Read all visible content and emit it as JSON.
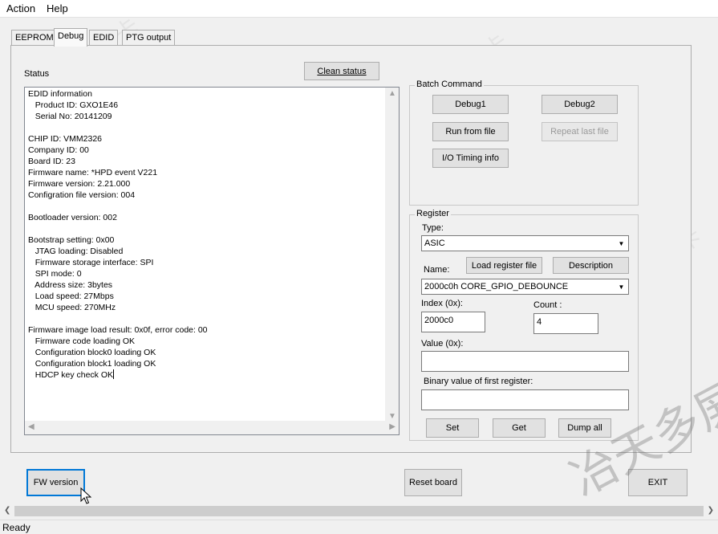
{
  "menu": {
    "action": "Action",
    "help": "Help"
  },
  "tabs": [
    "EEPROM",
    "Debug",
    "EDID",
    "PTG output"
  ],
  "status": {
    "label": "Status",
    "clean_button": "Clean status",
    "lines": "EDID information\n   Product ID: GXO1E46\n   Serial No: 20141209\n\nCHIP ID: VMM2326\nCompany ID: 00\nBoard ID: 23\nFirmware name: *HPD event V221\nFirmware version: 2.21.000\nConfigration file version: 004\n\nBootloader version: 002\n\nBootstrap setting: 0x00\n   JTAG loading: Disabled\n   Firmware storage interface: SPI\n   SPI mode: 0\n   Address size: 3bytes\n   Load speed: 27Mbps\n   MCU speed: 270MHz\n\nFirmware image load result: 0x0f, error code: 00\n   Firmware code loading OK\n   Configuration block0 loading OK\n   Configuration block1 loading OK\n   HDCP key check OK"
  },
  "batch": {
    "title": "Batch Command",
    "debug1": "Debug1",
    "debug2": "Debug2",
    "run_from_file": "Run from file",
    "repeat_last_file": "Repeat last file",
    "io_timing_info": "I/O Timing info"
  },
  "register": {
    "title": "Register",
    "type_label": "Type:",
    "type_value": "ASIC",
    "name_label": "Name:",
    "load_register_file": "Load register file",
    "description": "Description",
    "name_value": "2000c0h CORE_GPIO_DEBOUNCE",
    "index_label": "Index (0x):",
    "index_value": "2000c0",
    "count_label": "Count :",
    "count_value": "4",
    "value_label": "Value (0x):",
    "value_value": "",
    "binary_label": "Binary value of first register:",
    "binary_value": "",
    "set": "Set",
    "get": "Get",
    "dump_all": "Dump all"
  },
  "bottom": {
    "fw_version": "FW version",
    "reset_board": "Reset board",
    "exit": "EXIT"
  },
  "statusbar": {
    "text": "Ready"
  },
  "watermark": {
    "small": "冶天显卡",
    "large": "冶天多屏"
  }
}
